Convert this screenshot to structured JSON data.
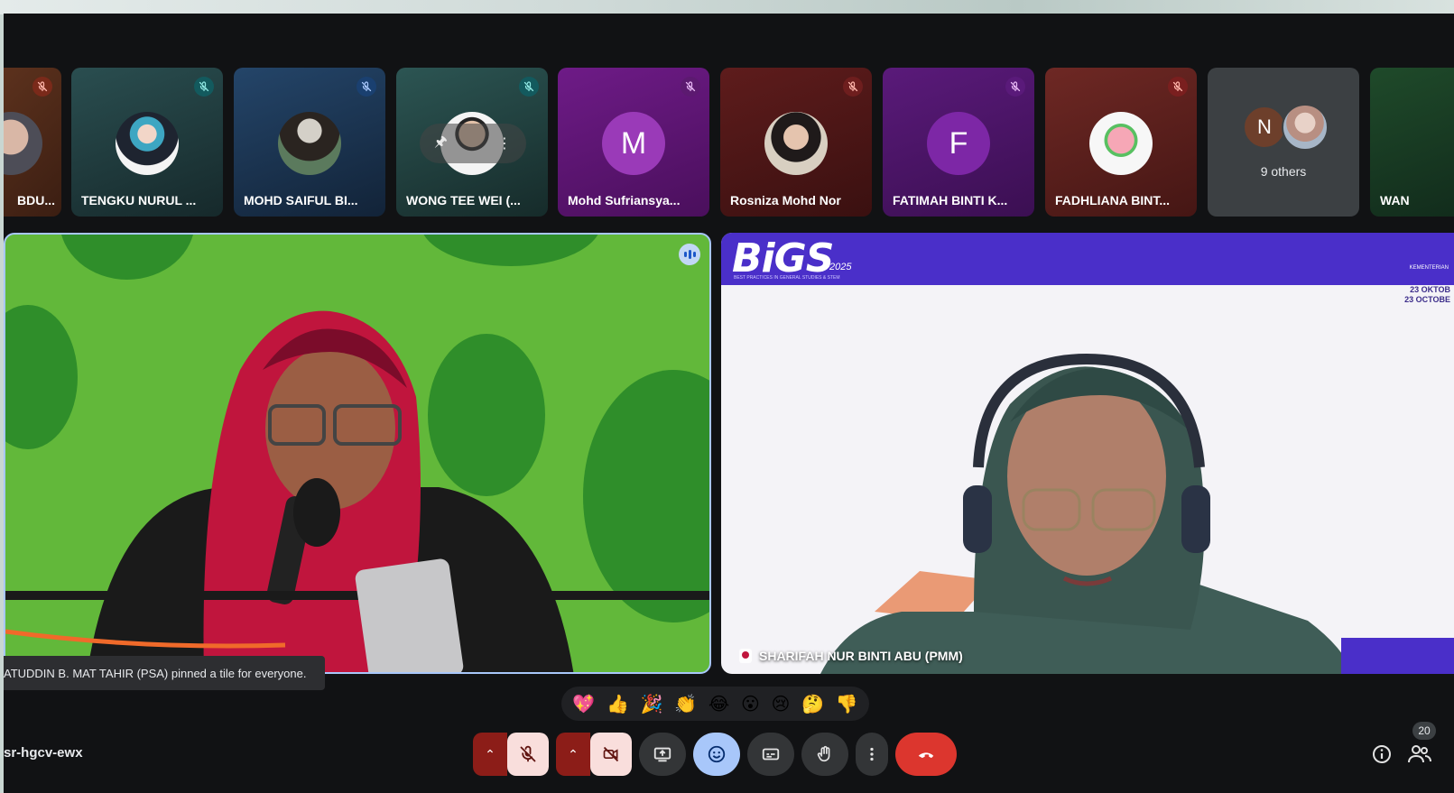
{
  "participants": [
    {
      "name": "BDU...",
      "color": "#5a2e1c",
      "muted": true,
      "avatar": "photo"
    },
    {
      "name": "TENGKU NURUL ...",
      "color": "#1f3a3b",
      "muted": true,
      "avatar": "photo"
    },
    {
      "name": "MOHD SAIFUL BI...",
      "color": "#19324f",
      "muted": true,
      "avatar": "photo"
    },
    {
      "name": "WONG TEE WEI (...",
      "color": "#1e3d3c",
      "muted": true,
      "avatar": "photo"
    },
    {
      "name": "Mohd Sufriansya...",
      "color": "#5c1670",
      "muted": true,
      "avatar": "letter",
      "letter": "M",
      "avatar_color": "#9a3ab8"
    },
    {
      "name": "Rosniza Mohd Nor",
      "color": "#4c1616",
      "muted": true,
      "avatar": "photo"
    },
    {
      "name": "FATIMAH BINTI K...",
      "color": "#4a1568",
      "muted": true,
      "avatar": "letter",
      "letter": "F",
      "avatar_color": "#7d27a6"
    },
    {
      "name": "FADHLIANA BINT...",
      "color": "#5a1f1d",
      "muted": true,
      "avatar": "photo"
    }
  ],
  "others": {
    "letter": "N",
    "label": "9 others"
  },
  "partial_tile": {
    "name": "WAN"
  },
  "main_left": {
    "speaker_name": "...URFADHLIATUDDIN B. MAT TAHIR (PSA)"
  },
  "main_right": {
    "logo": "BiGS",
    "logo_year": "2025",
    "logo_sub": "BEST PRACTICES IN GENERAL STUDIES & STEM",
    "date_line1": "23 OKTOB",
    "date_line2": "23 OCTOBE",
    "ministry": "KEMENTERIAN",
    "speaker_name": "SHARIFAH NUR BINTI ABU (PMM)"
  },
  "toast": {
    "text": "ATUDDIN B. MAT TAHIR (PSA) pinned a tile for everyone."
  },
  "reactions": [
    "💖",
    "👍",
    "🎉",
    "👏",
    "😂",
    "😮",
    "😢",
    "🤔",
    "👎"
  ],
  "meeting_code": "sr-hgcv-ewx",
  "people_count": "20",
  "colors": {
    "accent_blue": "#a8c7fa",
    "end_call_red": "#dc362e",
    "muted_red": "#8c1d18"
  }
}
